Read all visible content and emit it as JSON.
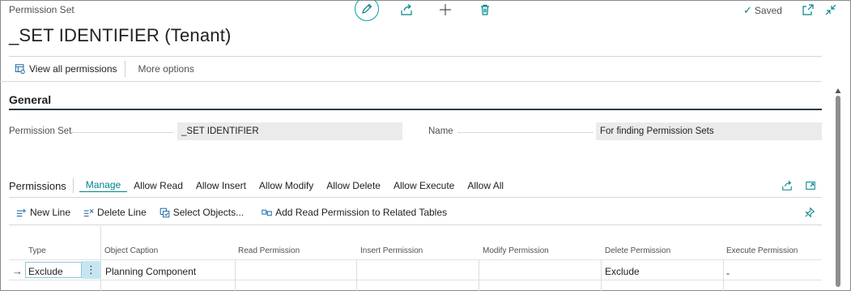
{
  "page": {
    "caption": "Permission Set",
    "title": "_SET IDENTIFIER (Tenant)",
    "saved_label": "Saved"
  },
  "action_bar": {
    "view_all": "View all permissions",
    "more_options": "More options"
  },
  "general": {
    "title": "General",
    "permission_set_label": "Permission Set",
    "permission_set_value": "_SET IDENTIFIER",
    "name_label": "Name",
    "name_value": "For finding Permission Sets"
  },
  "permissions": {
    "title": "Permissions",
    "tabs": [
      "Manage",
      "Allow Read",
      "Allow Insert",
      "Allow Modify",
      "Allow Delete",
      "Allow Execute",
      "Allow All"
    ],
    "actions": [
      "New Line",
      "Delete Line",
      "Select Objects...",
      "Add Read Permission to Related Tables"
    ],
    "columns": [
      "Type",
      "Object Caption",
      "Read Permission",
      "Insert Permission",
      "Modify Permission",
      "Delete Permission",
      "Execute Permission"
    ],
    "rows": [
      {
        "type": "Exclude",
        "object_caption": "Planning Component",
        "read": "",
        "insert": "",
        "modify": "",
        "delete": "Exclude",
        "execute": "-"
      }
    ]
  },
  "colors": {
    "accent": "#008489",
    "section_rule": "#2a3b4a",
    "field_bg": "#ebebeb",
    "row_selected": "#c5e6f1"
  }
}
